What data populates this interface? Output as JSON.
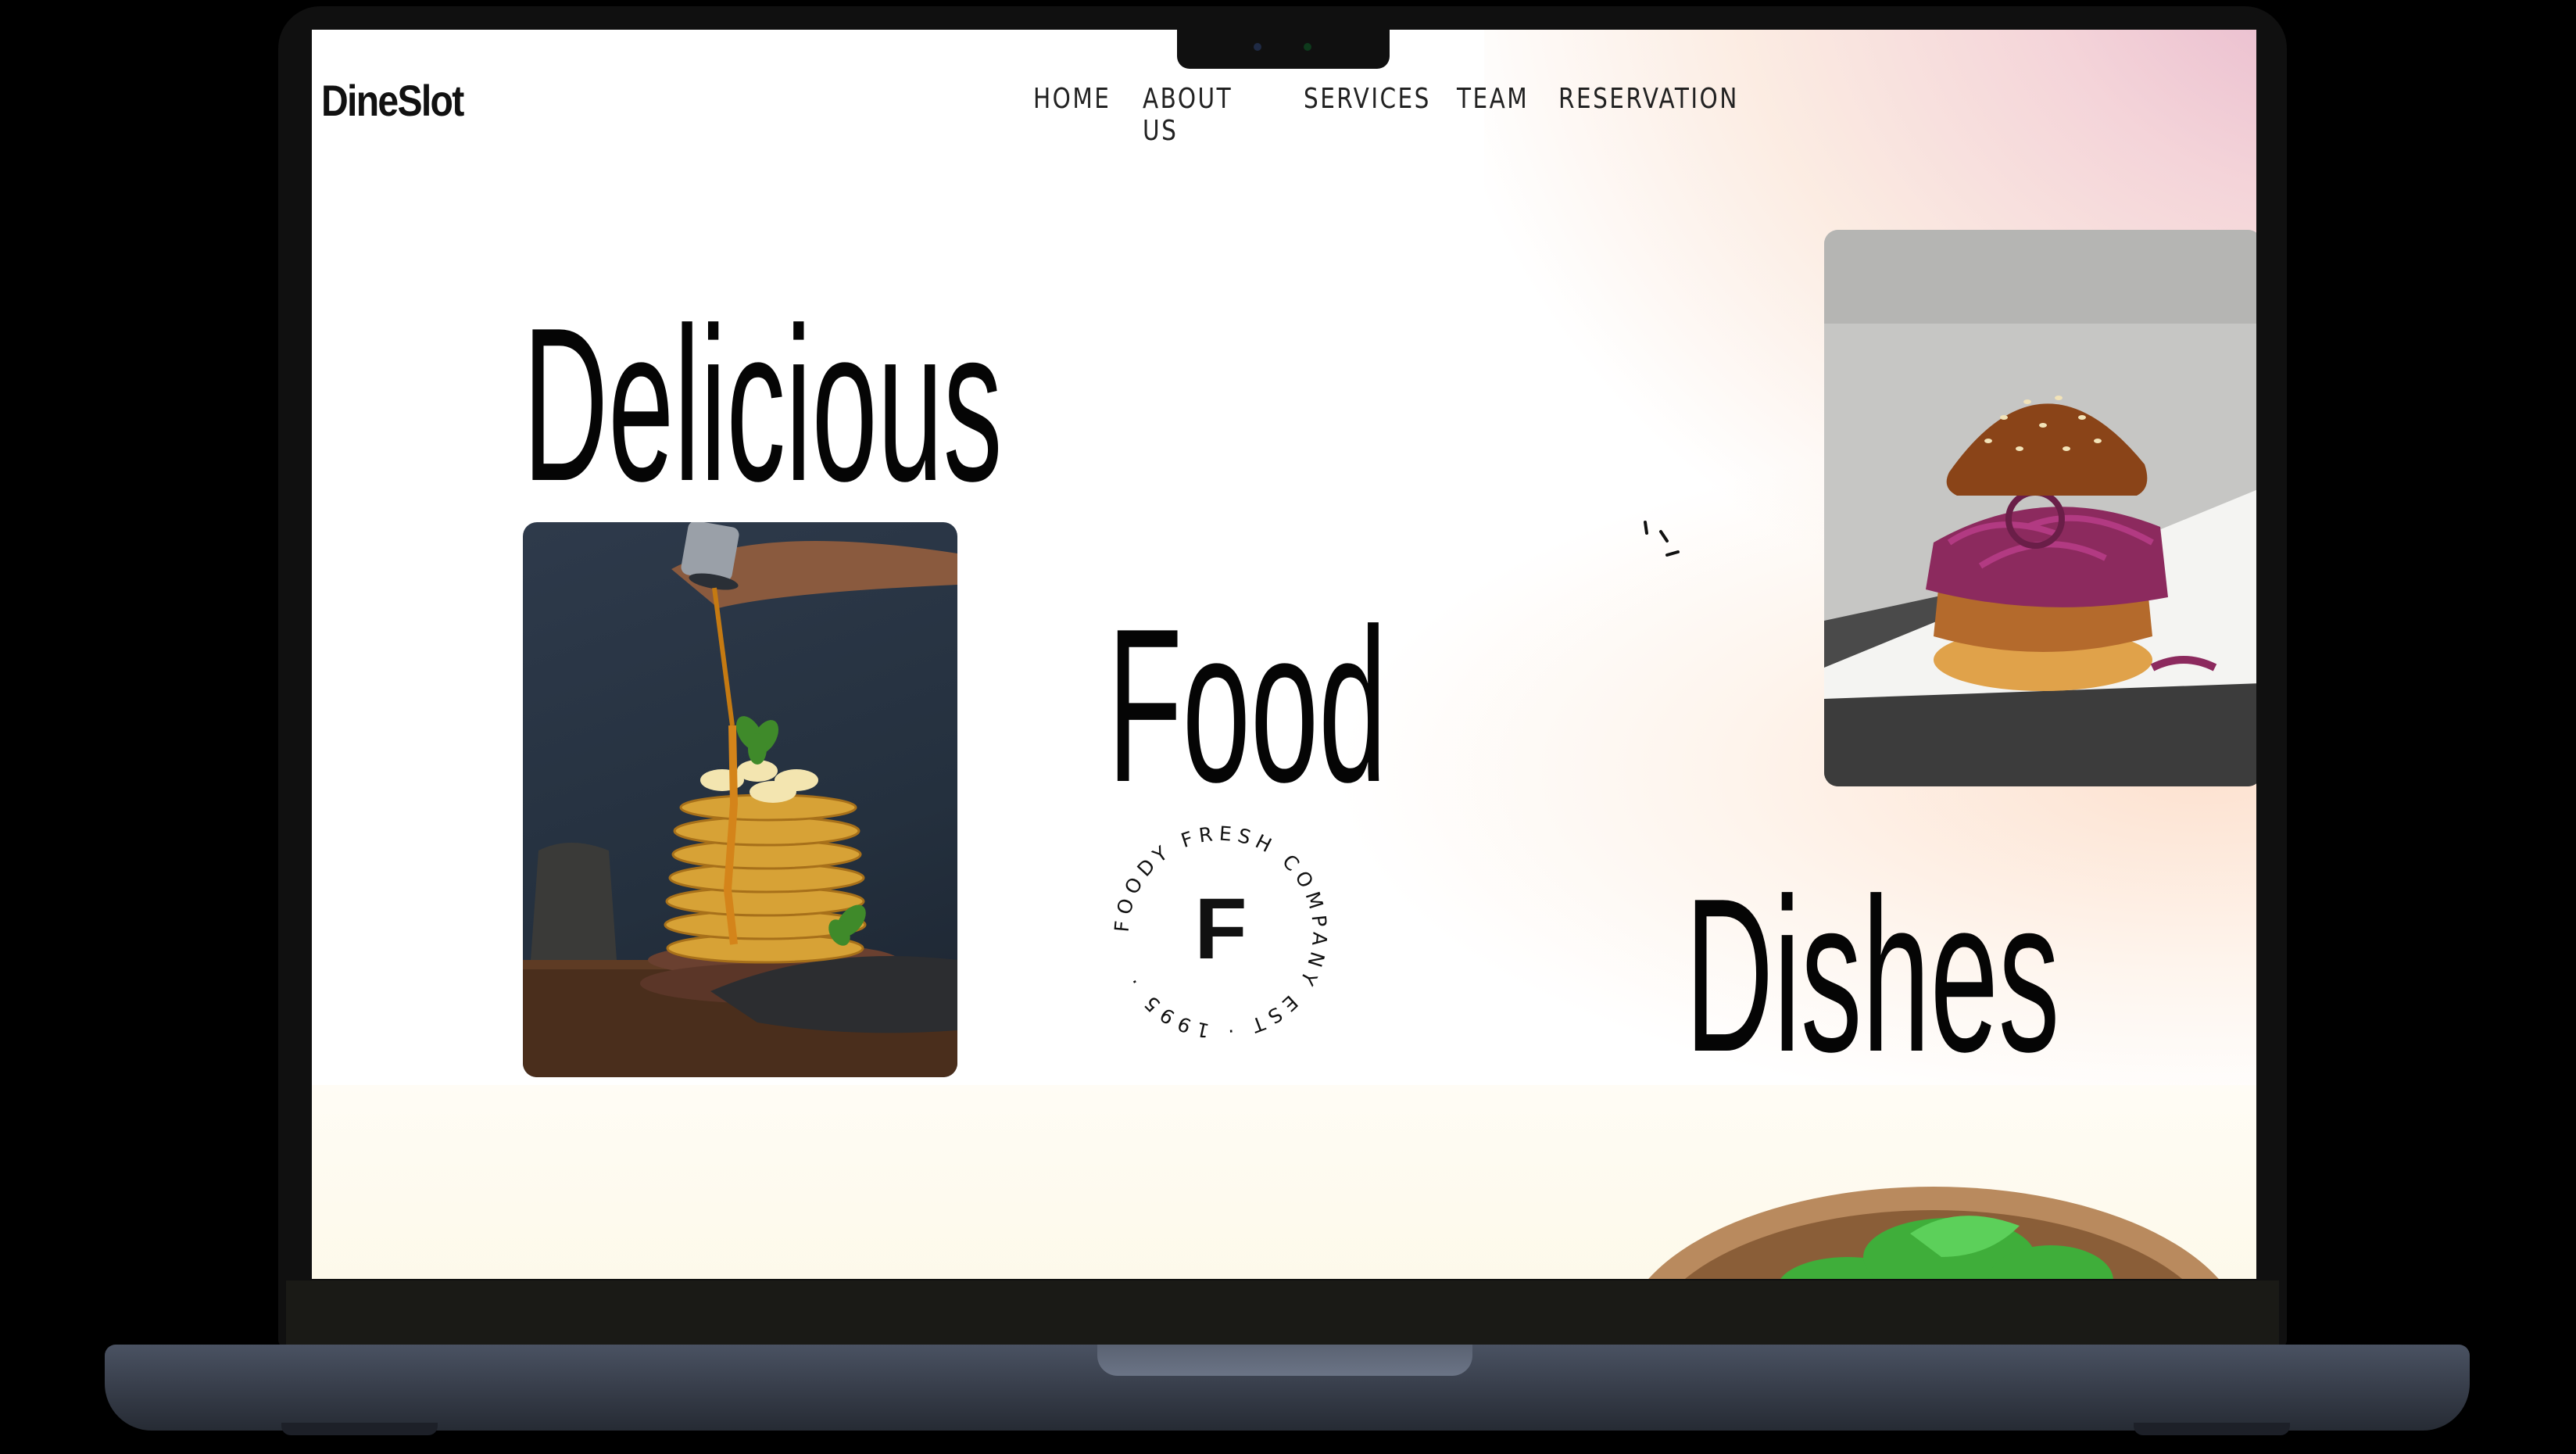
{
  "site": {
    "logo": "DineSlot",
    "nav": [
      "HOME",
      "ABOUT US",
      "SERVICES",
      "TEAM",
      "RESERVATION"
    ]
  },
  "hero": {
    "word1": "Delicious",
    "word2": "Food",
    "word3": "Dishes"
  },
  "badge": {
    "letter": "F",
    "ring_text": "FOODY FRESH COMPANY EST · 1995 ·"
  },
  "images": {
    "left": "pancake-stack-photo",
    "right": "fried-chicken-burger-photo",
    "bottom": "salad-bowl-photo"
  },
  "colors": {
    "accent_pink": "#e6b5cb",
    "accent_peach": "#fcdac4",
    "text": "#050505"
  }
}
